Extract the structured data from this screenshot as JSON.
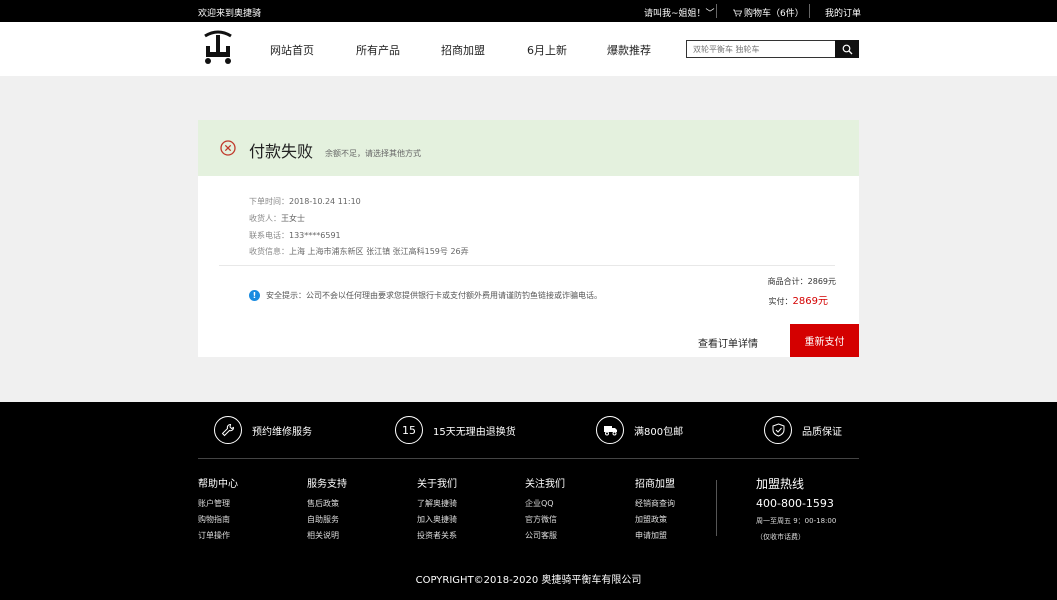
{
  "topbar": {
    "welcome": "欢迎来到奥捷骑",
    "user": "请叫我~姐姐！",
    "cart": "购物车（6件）",
    "orders": "我的订单"
  },
  "nav": {
    "items": [
      "网站首页",
      "所有产品",
      "招商加盟",
      "6月上新",
      "爆款推荐"
    ]
  },
  "search": {
    "placeholder": "双轮平衡车    独轮车"
  },
  "status": {
    "title": "付款失败",
    "subtitle": "余额不足，请选择其他方式"
  },
  "order": {
    "time_label": "下单时间：",
    "time": "2018-10.24 11:10",
    "recipient_label": "收货人：",
    "recipient": "王女士",
    "phone_label": "联系电话：",
    "phone": "133****6591",
    "address_label": "收货信息：",
    "address": "上海 上海市浦东新区 张江镇 张江高科159号 26弄",
    "tip_label": "安全提示：",
    "tip": "公司不会以任何理由要求您提供银行卡或支付额外费用请谨防钓鱼链接或诈骗电话。",
    "subtotal_label": "商品合计：",
    "subtotal": "2869元",
    "paid_label": "实付：",
    "paid": "2869元",
    "detail_link": "查看订单详情",
    "repay_button": "重新支付"
  },
  "footer": {
    "features": [
      {
        "icon": "wrench-icon",
        "label": "预约维修服务"
      },
      {
        "icon": "fifteen-days-icon",
        "glyph": "15",
        "label": "15天无理由退换货"
      },
      {
        "icon": "truck-icon",
        "label": "满800包邮"
      },
      {
        "icon": "shield-check-icon",
        "label": "品质保证"
      }
    ],
    "columns": [
      {
        "title": "帮助中心",
        "items": [
          "账户管理",
          "购物指南",
          "订单操作"
        ]
      },
      {
        "title": "服务支持",
        "items": [
          "售后政策",
          "自助服务",
          "相关说明"
        ]
      },
      {
        "title": "关于我们",
        "items": [
          "了解奥捷骑",
          "加入奥捷骑",
          "投资者关系"
        ]
      },
      {
        "title": "关注我们",
        "items": [
          "企业QQ",
          "官方微信",
          "公司客服"
        ]
      },
      {
        "title": "招商加盟",
        "items": [
          "经销商查询",
          "加盟政策",
          "申请加盟"
        ]
      }
    ],
    "hotline": {
      "title": "加盟热线",
      "number": "400-800-1593",
      "hours": "周一至周五 9：00-18:00",
      "note": "（仅收市话费）"
    },
    "copyright": "COPYRIGHT©2018-2020 奥捷骑平衡车有限公司"
  },
  "colors": {
    "accent": "#d40000",
    "status_band": "#e4f1de",
    "tip_icon": "#1a8be0"
  }
}
